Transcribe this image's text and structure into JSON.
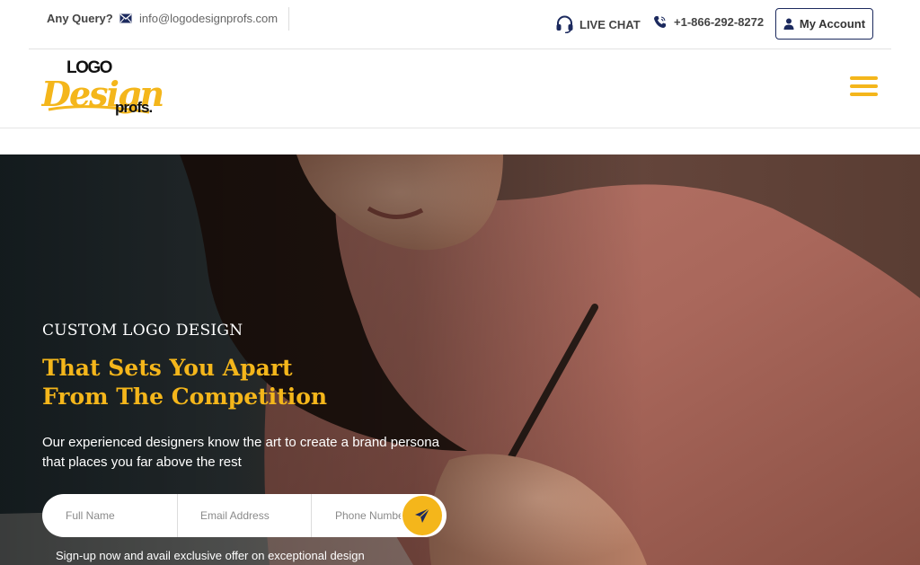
{
  "topbar": {
    "query_label": "Any Query?",
    "email": "info@logodesignprofs.com",
    "live_chat": "LIVE CHAT",
    "phone": "+1-866-292-8272",
    "account": "My Account"
  },
  "logo": {
    "line1": "LOGO",
    "line2": "Design",
    "line3": "profs."
  },
  "hero": {
    "eyebrow": "CUSTOM LOGO DESIGN",
    "headline_line1": "That Sets You Apart",
    "headline_line2": "From The Competition",
    "description": "Our experienced designers know the art to create a brand persona that places you far above the rest",
    "form": {
      "name_placeholder": "Full Name",
      "email_placeholder": "Email Address",
      "phone_placeholder": "Phone Number"
    },
    "promo": "Sign-up now and avail exclusive offer on exceptional design"
  },
  "colors": {
    "accent": "#f4b61b",
    "navy": "#1c2a5e"
  },
  "icons": [
    "mail-icon",
    "headset-icon",
    "phone-icon",
    "user-icon",
    "menu-icon",
    "send-icon"
  ]
}
